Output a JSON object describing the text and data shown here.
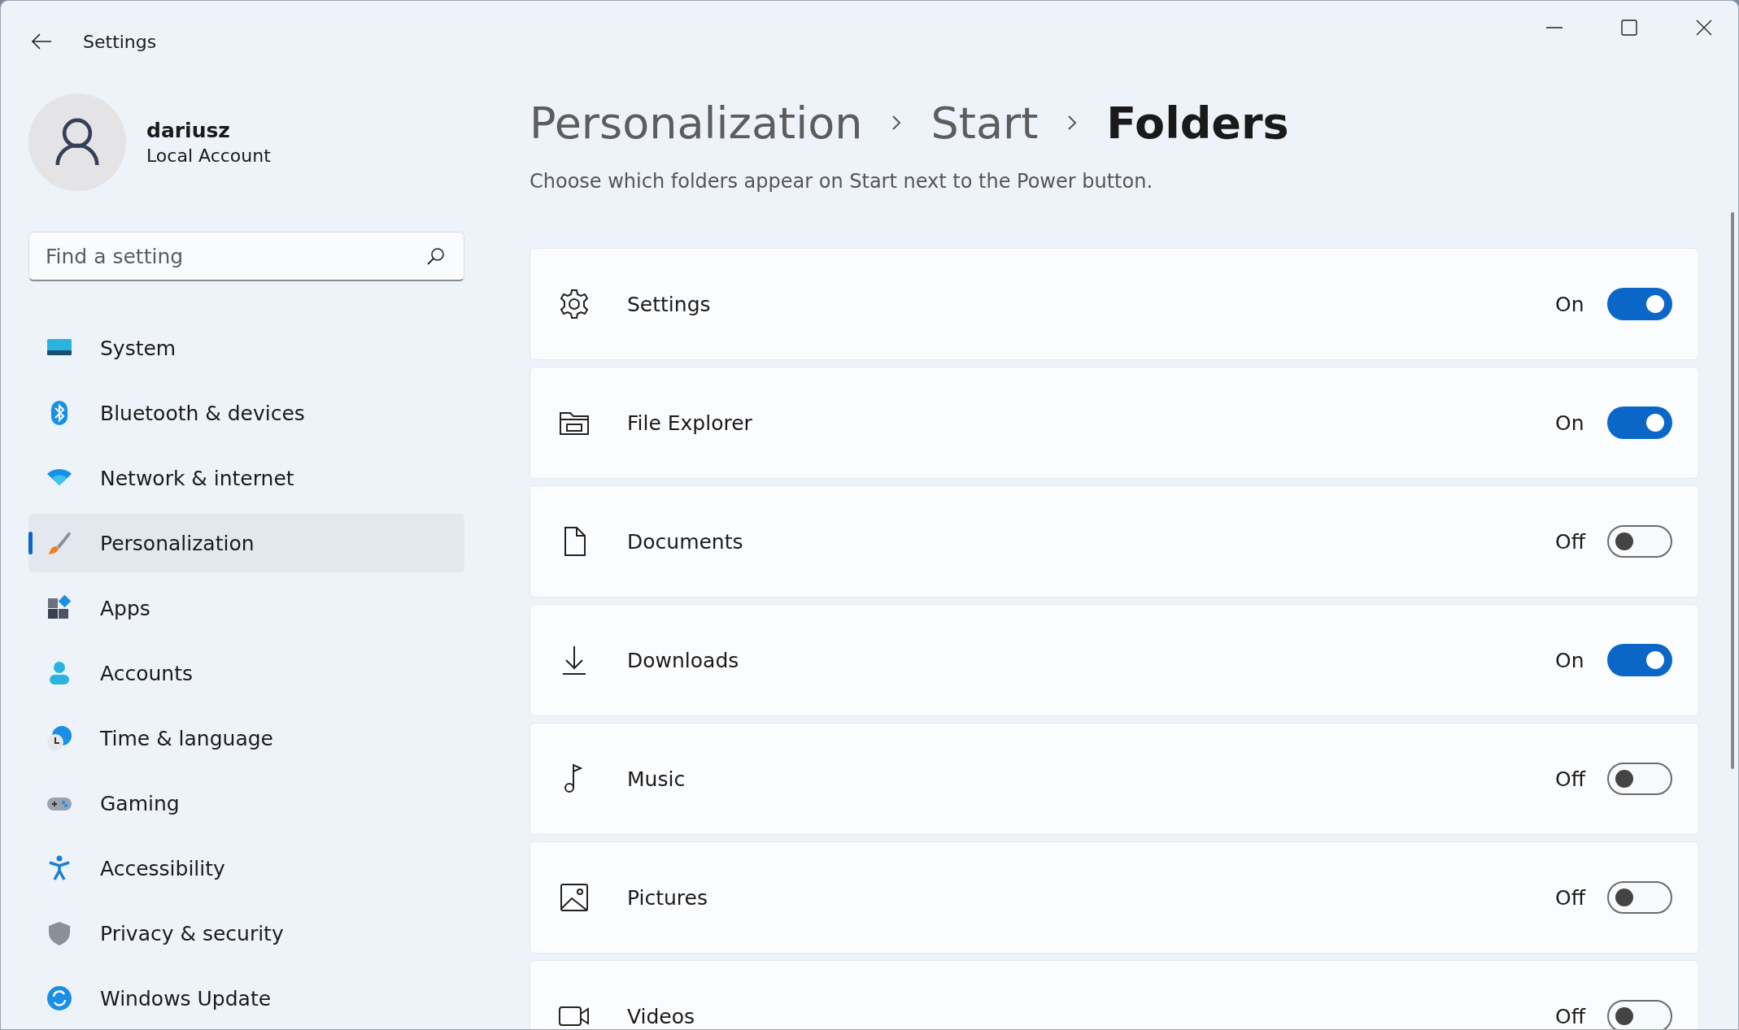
{
  "window": {
    "title": "Settings"
  },
  "account": {
    "name": "dariusz",
    "type": "Local Account"
  },
  "search": {
    "placeholder": "Find a setting"
  },
  "sidebar": {
    "items": [
      {
        "label": "System",
        "selected": false
      },
      {
        "label": "Bluetooth & devices",
        "selected": false
      },
      {
        "label": "Network & internet",
        "selected": false
      },
      {
        "label": "Personalization",
        "selected": true
      },
      {
        "label": "Apps",
        "selected": false
      },
      {
        "label": "Accounts",
        "selected": false
      },
      {
        "label": "Time & language",
        "selected": false
      },
      {
        "label": "Gaming",
        "selected": false
      },
      {
        "label": "Accessibility",
        "selected": false
      },
      {
        "label": "Privacy & security",
        "selected": false
      },
      {
        "label": "Windows Update",
        "selected": false
      }
    ]
  },
  "breadcrumb": [
    "Personalization",
    "Start",
    "Folders"
  ],
  "description": "Choose which folders appear on Start next to the Power button.",
  "folders": [
    {
      "label": "Settings",
      "on": true,
      "status": "On"
    },
    {
      "label": "File Explorer",
      "on": true,
      "status": "On"
    },
    {
      "label": "Documents",
      "on": false,
      "status": "Off"
    },
    {
      "label": "Downloads",
      "on": true,
      "status": "On"
    },
    {
      "label": "Music",
      "on": false,
      "status": "Off"
    },
    {
      "label": "Pictures",
      "on": false,
      "status": "Off"
    },
    {
      "label": "Videos",
      "on": false,
      "status": "Off"
    }
  ]
}
